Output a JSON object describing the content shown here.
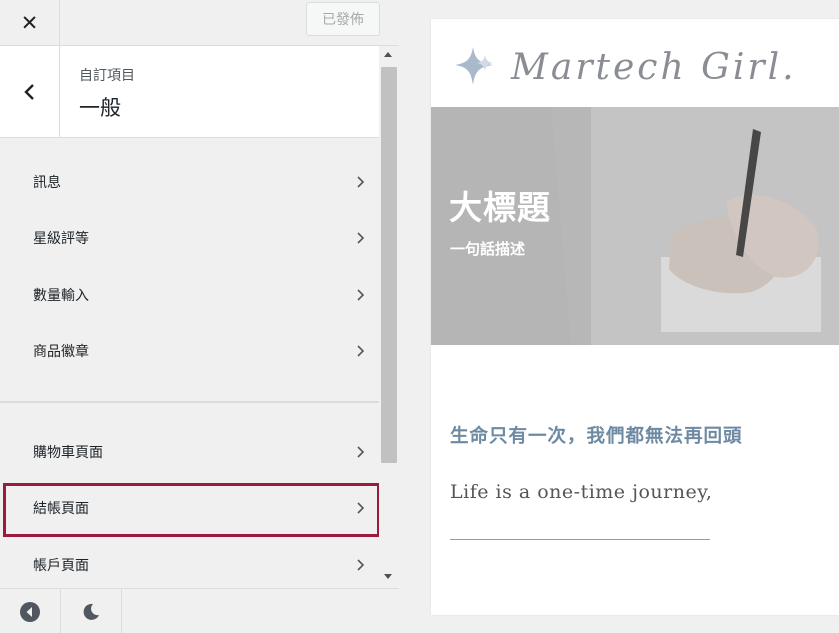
{
  "topbar": {
    "close_icon": "close-icon",
    "publish_label": "已發佈"
  },
  "section": {
    "parent": "自訂項目",
    "title": "一般",
    "back_icon": "chevron-left-icon"
  },
  "menu": {
    "group1": [
      {
        "label": "訊息"
      },
      {
        "label": "星級評等"
      },
      {
        "label": "數量輸入"
      },
      {
        "label": "商品徽章"
      }
    ],
    "group2": [
      {
        "label": "購物車頁面"
      },
      {
        "label": "結帳頁面",
        "highlighted": true
      },
      {
        "label": "帳戶頁面"
      }
    ]
  },
  "footer": {
    "buttons": [
      "preview-toggle-icon",
      "dark-mode-icon"
    ]
  },
  "colors": {
    "highlight": "#9b1b3a",
    "accent_text": "#6e8aa3",
    "sidebar_bg": "#f0f0f1"
  },
  "preview": {
    "logo_text": "Martech Girl.",
    "hero": {
      "title": "大標題",
      "subtitle": "一句話描述"
    },
    "quote_zh": "生命只有一次，我們都無法再回頭",
    "quote_en": "Life is a one-time journey,"
  }
}
